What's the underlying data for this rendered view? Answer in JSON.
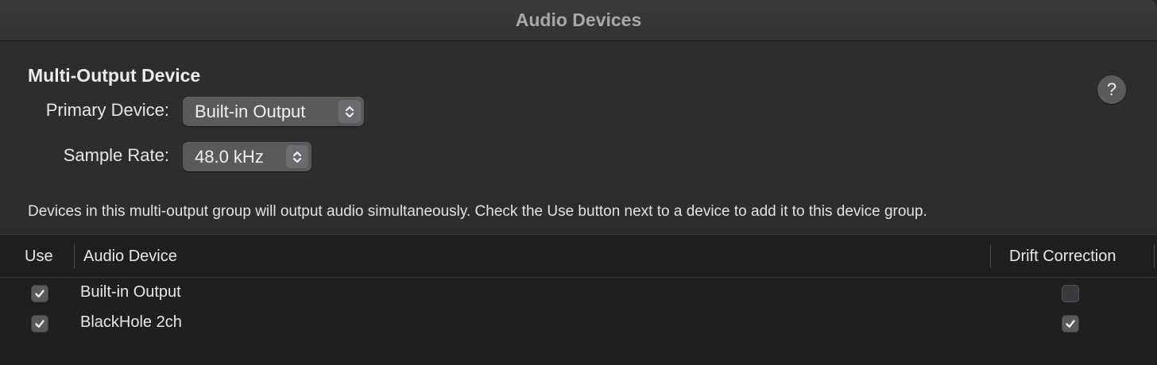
{
  "window": {
    "title": "Audio Devices"
  },
  "device": {
    "heading": "Multi-Output Device",
    "help_label": "?",
    "primary_device": {
      "label": "Primary Device:",
      "value": "Built-in Output"
    },
    "sample_rate": {
      "label": "Sample Rate:",
      "value": "48.0 kHz"
    },
    "description": "Devices in this multi-output group will output audio simultaneously. Check the Use button next to a device to add it to this device group."
  },
  "table": {
    "columns": {
      "use": "Use",
      "audio_device": "Audio Device",
      "drift_correction": "Drift Correction"
    },
    "rows": [
      {
        "use": true,
        "name": "Built-in Output",
        "drift_correction": false
      },
      {
        "use": true,
        "name": "BlackHole 2ch",
        "drift_correction": true
      }
    ]
  },
  "icons": {
    "popup_stepper": "up-down-chevron-icon",
    "checkmark": "checkmark-icon"
  }
}
